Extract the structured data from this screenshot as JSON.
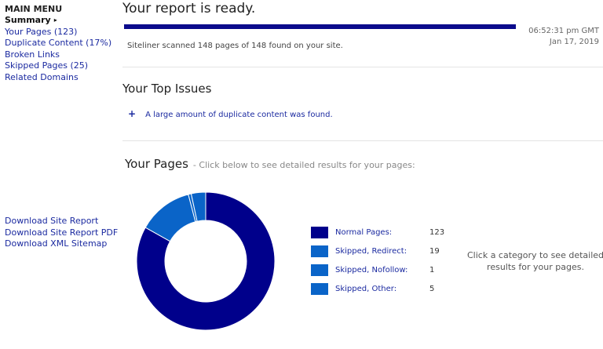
{
  "sidebar": {
    "title": "MAIN MENU",
    "items": [
      {
        "label": "Summary",
        "active": true
      },
      {
        "label": "Your Pages (123)"
      },
      {
        "label": "Duplicate Content (17%)"
      },
      {
        "label": "Broken Links"
      },
      {
        "label": "Skipped Pages (25)"
      },
      {
        "label": "Related Domains"
      }
    ],
    "active_arrow": "▸",
    "downloads": [
      "Download Site Report",
      "Download Site Report PDF",
      "Download XML Sitemap"
    ]
  },
  "report": {
    "title": "Your report is ready.",
    "progress": 1.0,
    "scan_text": "Siteliner scanned 148 pages of 148 found on your site.",
    "time": "06:52:31 pm GMT",
    "date": "Jan 17, 2019"
  },
  "issues": {
    "title": "Your Top Issues",
    "items": [
      {
        "icon": "+",
        "text": "A large amount of duplicate content was found."
      }
    ]
  },
  "pages": {
    "title": "Your Pages",
    "subtitle": "- Click below to see detailed results for your pages:",
    "note": "Click a category to see detailed results for your pages."
  },
  "chart_data": {
    "type": "pie",
    "categories": [
      "Normal Pages:",
      "Skipped, Redirect:",
      "Skipped, Nofollow:",
      "Skipped, Other:"
    ],
    "values": [
      123,
      19,
      1,
      5
    ],
    "colors": [
      "#00008b",
      "#0a64c8",
      "#0a64c8",
      "#0a64c8"
    ]
  }
}
